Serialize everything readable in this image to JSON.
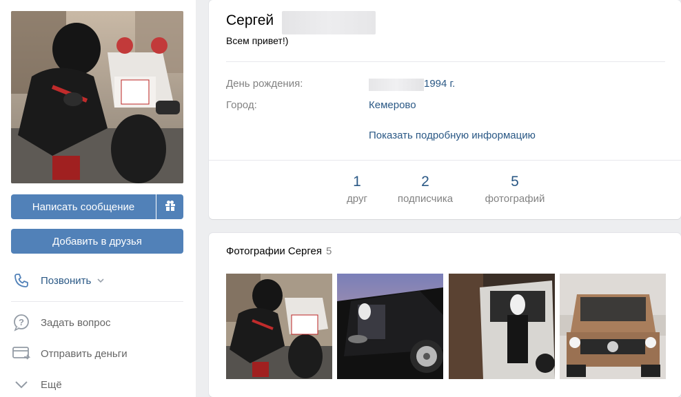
{
  "left": {
    "send_message": "Написать сообщение",
    "add_friend": "Добавить в друзья",
    "call": "Позвонить",
    "ask": "Задать вопрос",
    "send_money": "Отправить деньги",
    "more": "Ещё"
  },
  "profile": {
    "first_name": "Сергей",
    "status": "Всем привет!)",
    "birthday_label": "День рождения:",
    "birthday_year": "1994 г.",
    "city_label": "Город:",
    "city": "Кемерово",
    "more_info": "Показать подробную информацию",
    "counters": [
      {
        "num": "1",
        "label": "друг"
      },
      {
        "num": "2",
        "label": "подписчика"
      },
      {
        "num": "5",
        "label": "фотографий"
      }
    ]
  },
  "photos": {
    "title": "Фотографии Сергея",
    "count": "5"
  },
  "colors": {
    "accent": "#5181b8",
    "link": "#2a5885",
    "background": "#edeef0"
  }
}
